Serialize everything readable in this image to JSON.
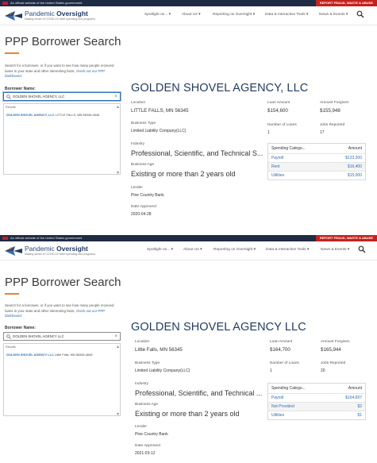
{
  "colors": {
    "accent": "#e6833a",
    "brand": "#1f3a66",
    "link": "#2f6db3",
    "report": "#c3221e",
    "banner": "#1f2a44"
  },
  "icons": [
    "flag-icon",
    "logo-icon",
    "search-icon",
    "magnifier-icon",
    "close-icon"
  ],
  "screens": [
    {
      "banner": {
        "gov_text": "An official website of the United States government",
        "report_label": "REPORT FRAUD, WASTE & ABUSE"
      },
      "brand": {
        "name_a": "Pandemic ",
        "name_b": "Oversight",
        "tagline": "Making sense of COVID-19 relief spending and programs"
      },
      "nav": {
        "spotlight": "Spotlight on... ▾",
        "about": "About Us ▾",
        "reporting": "Reporting on Oversight ▾",
        "data": "Data & Interactive Tools ▾",
        "news": "News & Events ▾"
      },
      "page_title": "PPP Borrower Search",
      "intro": {
        "text": "Search for a borrower, or if you want to see how many people received loans in your state and other interesting facts, ",
        "link": "check out our PPP dashboard."
      },
      "search": {
        "label": "Borrower Name:",
        "value": "GOLDEN SHOVEL AGENCY, LLC",
        "results_header": "Results",
        "result_name": "GOLDEN SHOVEL AGENCY, LLC",
        "result_location": "LITTLE FALLS, MN 56345-4646"
      },
      "company": "GOLDEN SHOVEL AGENCY, LLC",
      "location": {
        "label": "Location",
        "value": "LITTLE FALLS, MN 56345"
      },
      "business_type": {
        "label": "Business Type",
        "value": "Limited  Liability Company(LLC)"
      },
      "industry": {
        "label": "Industry",
        "value": "Professional, Scientific, and Technical S..."
      },
      "business_age": {
        "label": "Business Age",
        "value": "Existing or more than 2 years old"
      },
      "lender": {
        "label": "Lender",
        "value": "Pine Country Bank"
      },
      "date_approved": {
        "label": "Date Approved",
        "value": "2020-04-28"
      },
      "loan_amount": {
        "label": "Loan Amount",
        "value": "$154,600"
      },
      "amount_forgiven": {
        "label": "Amount Forgiven",
        "value": "$155,948"
      },
      "num_loans": {
        "label": "Number of Loans",
        "value": "1"
      },
      "jobs": {
        "label": "Jobs Reported",
        "value": "17"
      },
      "spending": {
        "header_cat": "Spending Catego...",
        "header_amt": "Amount",
        "rows": [
          {
            "cat": "Payroll",
            "amt": "$123,200"
          },
          {
            "cat": "Rent",
            "amt": "$16,400"
          },
          {
            "cat": "Utilities",
            "amt": "$15,000"
          }
        ]
      }
    },
    {
      "banner": {
        "gov_text": "An official website of the United States government",
        "report_label": "REPORT FRAUD, WASTE & ABUSE"
      },
      "brand": {
        "name_a": "Pandemic ",
        "name_b": "Oversight",
        "tagline": "Making sense of COVID-19 relief spending and programs"
      },
      "nav": {
        "spotlight": "Spotlight on... ▾",
        "about": "About Us ▾",
        "reporting": "Reporting on Oversight ▾",
        "data": "Data & Interactive Tools ▾",
        "news": "News & Events ▾"
      },
      "page_title": "PPP Borrower Search",
      "intro": {
        "text": "Search for a borrower, or if you want to see how many people received loans in your state and other interesting facts, ",
        "link": "check out our PPP dashboard."
      },
      "search": {
        "label": "Borrower Name:",
        "value": "GOLDEN SHOVEL AGENCY LLC",
        "results_header": "Results",
        "result_name": "GOLDEN SHOVEL AGENCY LLC",
        "result_location": "Little Falls, MN 56345-4646"
      },
      "company": "GOLDEN SHOVEL AGENCY LLC",
      "location": {
        "label": "Location",
        "value": "Little Falls, MN 56345"
      },
      "business_type": {
        "label": "Business Type",
        "value": "Limited  Liability Company(LLC)"
      },
      "industry": {
        "label": "Industry",
        "value": "Professional, Scientific, and Technical ..."
      },
      "business_age": {
        "label": "Business Age",
        "value": "Existing or more than 2 years old"
      },
      "lender": {
        "label": "Lender",
        "value": "Pine Country Bank"
      },
      "date_approved": {
        "label": "Date Approved",
        "value": "2021-03-12"
      },
      "loan_amount": {
        "label": "Loan Amount",
        "value": "$164,700"
      },
      "amount_forgiven": {
        "label": "Amount Forgiven",
        "value": "$165,944"
      },
      "num_loans": {
        "label": "Number of Loans",
        "value": "1"
      },
      "jobs": {
        "label": "Jobs Reported",
        "value": "20"
      },
      "spending": {
        "header_cat": "Spending Catego...",
        "header_amt": "Amount",
        "rows": [
          {
            "cat": "Payroll",
            "amt": "$164,697"
          },
          {
            "cat": "Not Provided",
            "amt": "$2"
          },
          {
            "cat": "Utilities",
            "amt": "$1"
          }
        ]
      }
    }
  ]
}
